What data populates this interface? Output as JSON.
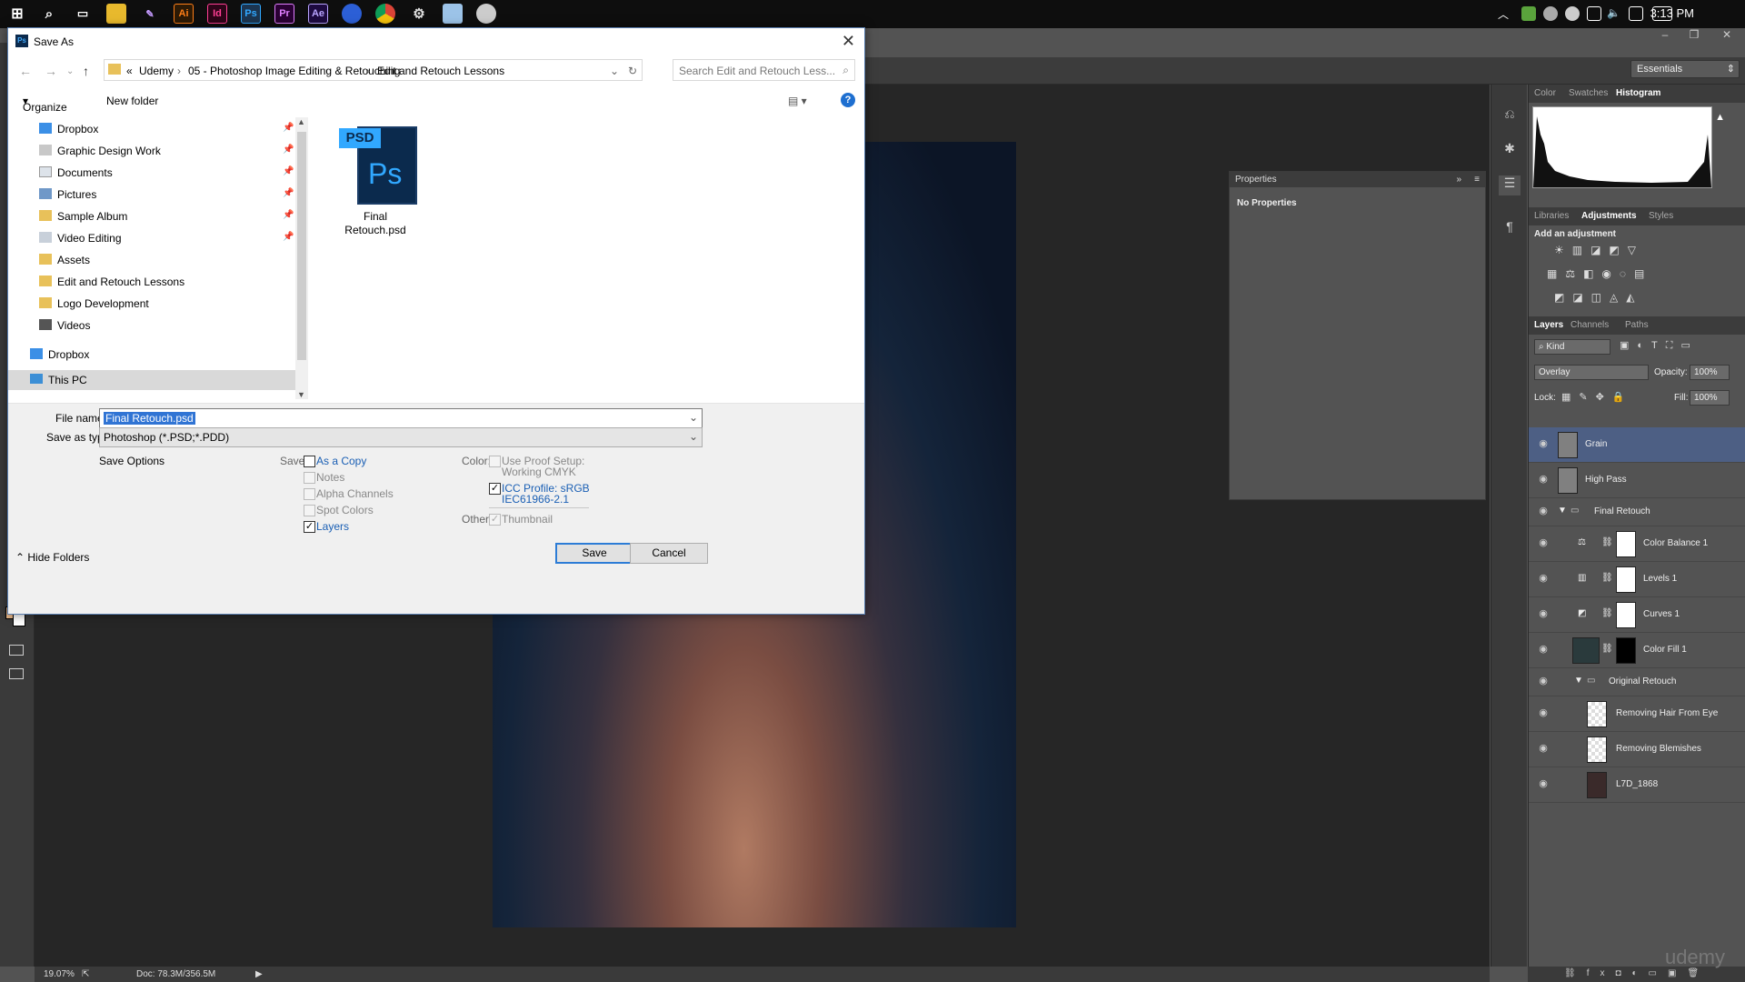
{
  "taskbar": {
    "clock": "3:13 PM",
    "icons": [
      {
        "name": "ai",
        "label": "Ai",
        "color": "#ff7f18",
        "bg": "#2d1a05"
      },
      {
        "name": "id",
        "label": "Id",
        "color": "#ff3f94",
        "bg": "#2d0418"
      },
      {
        "name": "ps",
        "label": "Ps",
        "color": "#31a8ff",
        "bg": "#001e36"
      },
      {
        "name": "pr",
        "label": "Pr",
        "color": "#e07fff",
        "bg": "#2a0034"
      },
      {
        "name": "ae",
        "label": "Ae",
        "color": "#b9a4ff",
        "bg": "#1d0a40"
      }
    ]
  },
  "dialog": {
    "title": "Save As",
    "address": {
      "prefix": "«",
      "segments": [
        "Udemy",
        "05 - Photoshop Image Editing & Retouching",
        "Edit and Retouch Lessons"
      ]
    },
    "search_placeholder": "Search Edit and Retouch Less...",
    "organize": "Organize",
    "new_folder": "New folder",
    "nav_items": [
      "Dropbox",
      "Graphic Design Work",
      "Documents",
      "Pictures",
      "Sample Album",
      "Video Editing",
      "Assets",
      "Edit and Retouch Lessons",
      "Logo Development",
      "Videos"
    ],
    "nav_roots": [
      "Dropbox",
      "This PC"
    ],
    "file": {
      "badge": "PSD",
      "icon_text": "Ps",
      "name_line1": "Final",
      "name_line2": "Retouch.psd"
    },
    "file_name_label": "File name:",
    "file_name_value": "Final Retouch.psd",
    "save_type_label": "Save as type:",
    "save_type_value": "Photoshop (*.PSD;*.PDD)",
    "save_options": "Save Options",
    "save_label": "Save:",
    "save_opts": {
      "as_copy": "As a Copy",
      "notes": "Notes",
      "alpha": "Alpha Channels",
      "spot": "Spot Colors",
      "layers": "Layers"
    },
    "color_label": "Color:",
    "proof_setup": "Use Proof Setup:",
    "proof_value": "Working CMYK",
    "icc_line1": "ICC Profile:  sRGB",
    "icc_line2": "IEC61966-2.1",
    "other_label": "Other:",
    "thumbnail": "Thumbnail",
    "hide_folders": "Hide Folders",
    "save_button": "Save",
    "cancel_button": "Cancel"
  },
  "photoshop": {
    "workspace": "Essentials",
    "properties_title": "Properties",
    "no_properties": "No Properties",
    "tabs_top": [
      "Color",
      "Swatches",
      "Histogram"
    ],
    "tabs_adj": [
      "Libraries",
      "Adjustments",
      "Styles"
    ],
    "add_adjustment": "Add an adjustment",
    "tabs_layers": [
      "Layers",
      "Channels",
      "Paths"
    ],
    "kind": "Kind",
    "blend_mode": "Overlay",
    "opacity_label": "Opacity:",
    "opacity_value": "100%",
    "lock_label": "Lock:",
    "fill_label": "Fill:",
    "fill_value": "100%",
    "layers": [
      "Grain",
      "High Pass",
      "Final Retouch",
      "Color Balance 1",
      "Levels 1",
      "Curves 1",
      "Color Fill 1",
      "Original Retouch",
      "Removing Hair From Eye",
      "Removing Blemishes",
      "L7D_1868"
    ],
    "status_zoom": "19.07%",
    "status_doc": "Doc: 78.3M/356.5M",
    "watermark": "udemy",
    "accent_selected": "#4d5f84"
  }
}
